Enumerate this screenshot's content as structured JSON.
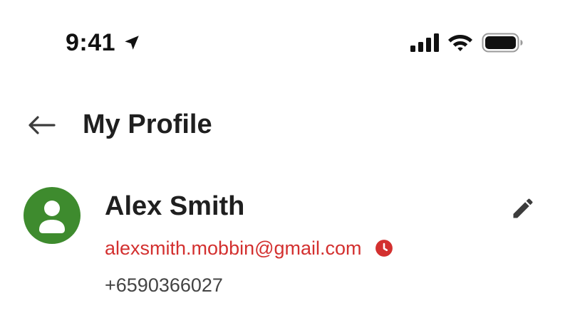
{
  "status_bar": {
    "time": "9:41",
    "icons": [
      "location-arrow-icon",
      "cellular-signal-icon",
      "wifi-icon",
      "battery-icon"
    ]
  },
  "header": {
    "title": "My Profile",
    "back_icon": "arrow-left-icon"
  },
  "profile": {
    "name": "Alex Smith",
    "email": "alexsmith.mobbin@gmail.com",
    "phone": "+6590366027",
    "avatar_icon": "person-icon",
    "edit_icon": "pencil-icon",
    "email_status_icon": "clock-icon"
  },
  "colors": {
    "avatar_bg": "#3e8b2e",
    "email": "#d3302f",
    "title": "#1f1f1f",
    "phone": "#444444",
    "icon": "#3c3c3c"
  }
}
